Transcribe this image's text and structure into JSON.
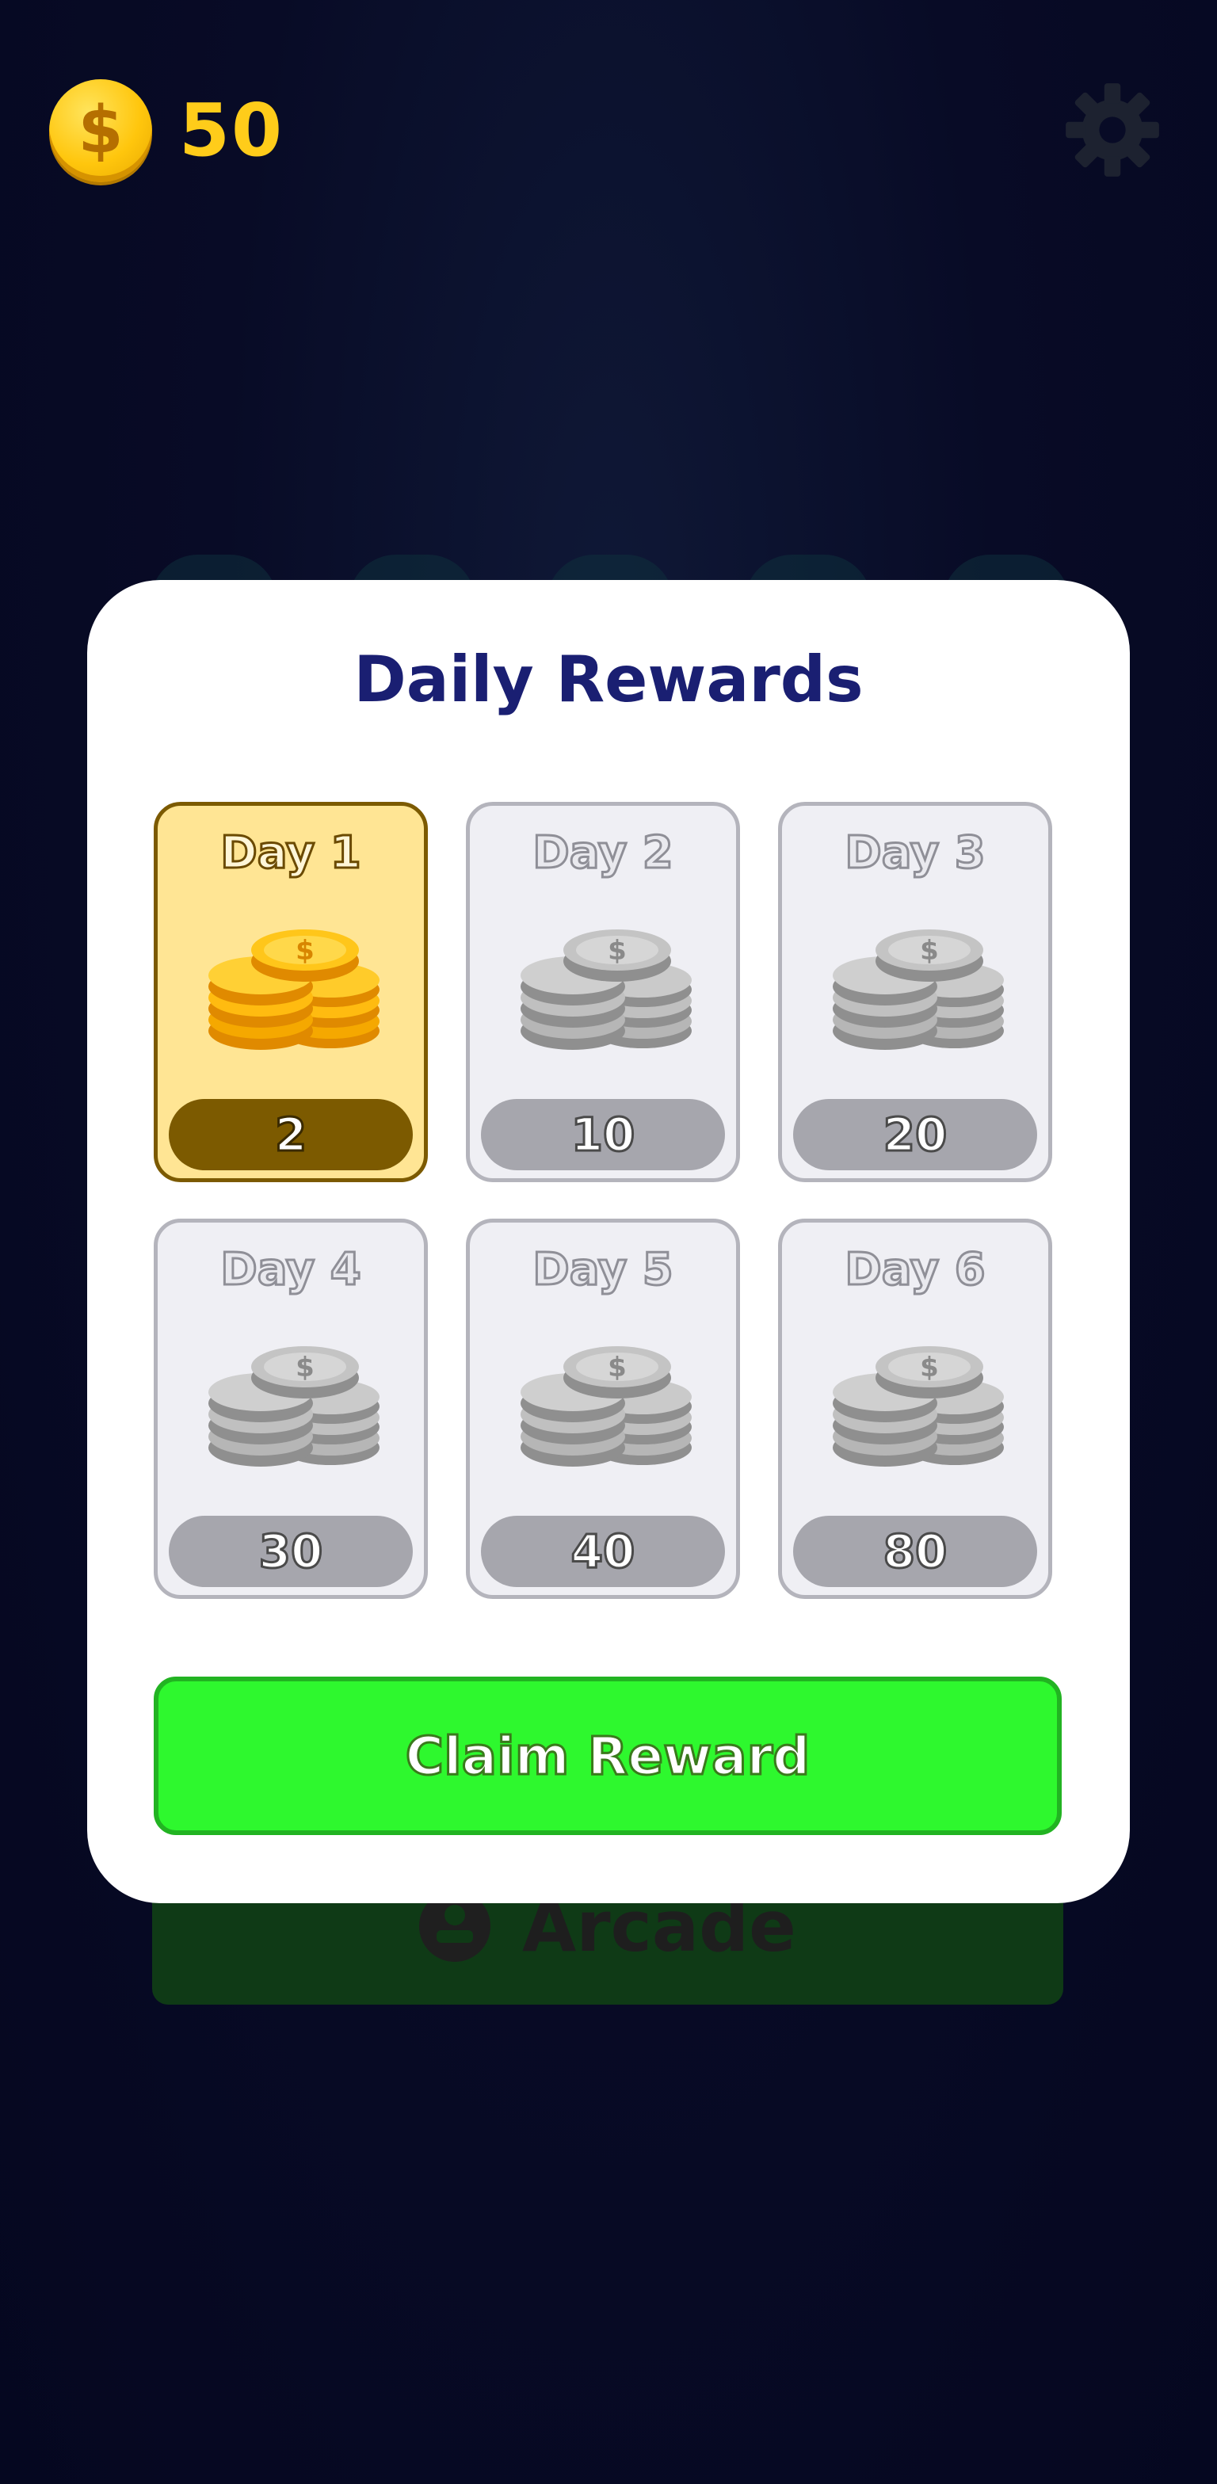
{
  "hud": {
    "currency_symbol": "$",
    "coin_count": "50",
    "settings_icon": "gear-icon"
  },
  "background": {
    "arcade_label": "Arcade",
    "arcade_icon": "joystick-icon"
  },
  "modal": {
    "title": "Daily Rewards",
    "cards": [
      {
        "day": "Day 1",
        "amount": "2",
        "state": "active",
        "icon": "gold-coin-stack-icon"
      },
      {
        "day": "Day 2",
        "amount": "10",
        "state": "locked",
        "icon": "silver-coin-stack-icon"
      },
      {
        "day": "Day 3",
        "amount": "20",
        "state": "locked",
        "icon": "silver-coin-stack-icon"
      },
      {
        "day": "Day 4",
        "amount": "30",
        "state": "locked",
        "icon": "silver-coin-stack-icon"
      },
      {
        "day": "Day 5",
        "amount": "40",
        "state": "locked",
        "icon": "silver-coin-stack-icon"
      },
      {
        "day": "Day 6",
        "amount": "80",
        "state": "locked",
        "icon": "silver-coin-stack-icon"
      }
    ],
    "claim_label": "Claim Reward"
  },
  "colors": {
    "background": "#06081f",
    "gold": "#ffcc1a",
    "title": "#1a1f72",
    "active_card": "#ffe594",
    "claim_button": "#2ef82e"
  }
}
